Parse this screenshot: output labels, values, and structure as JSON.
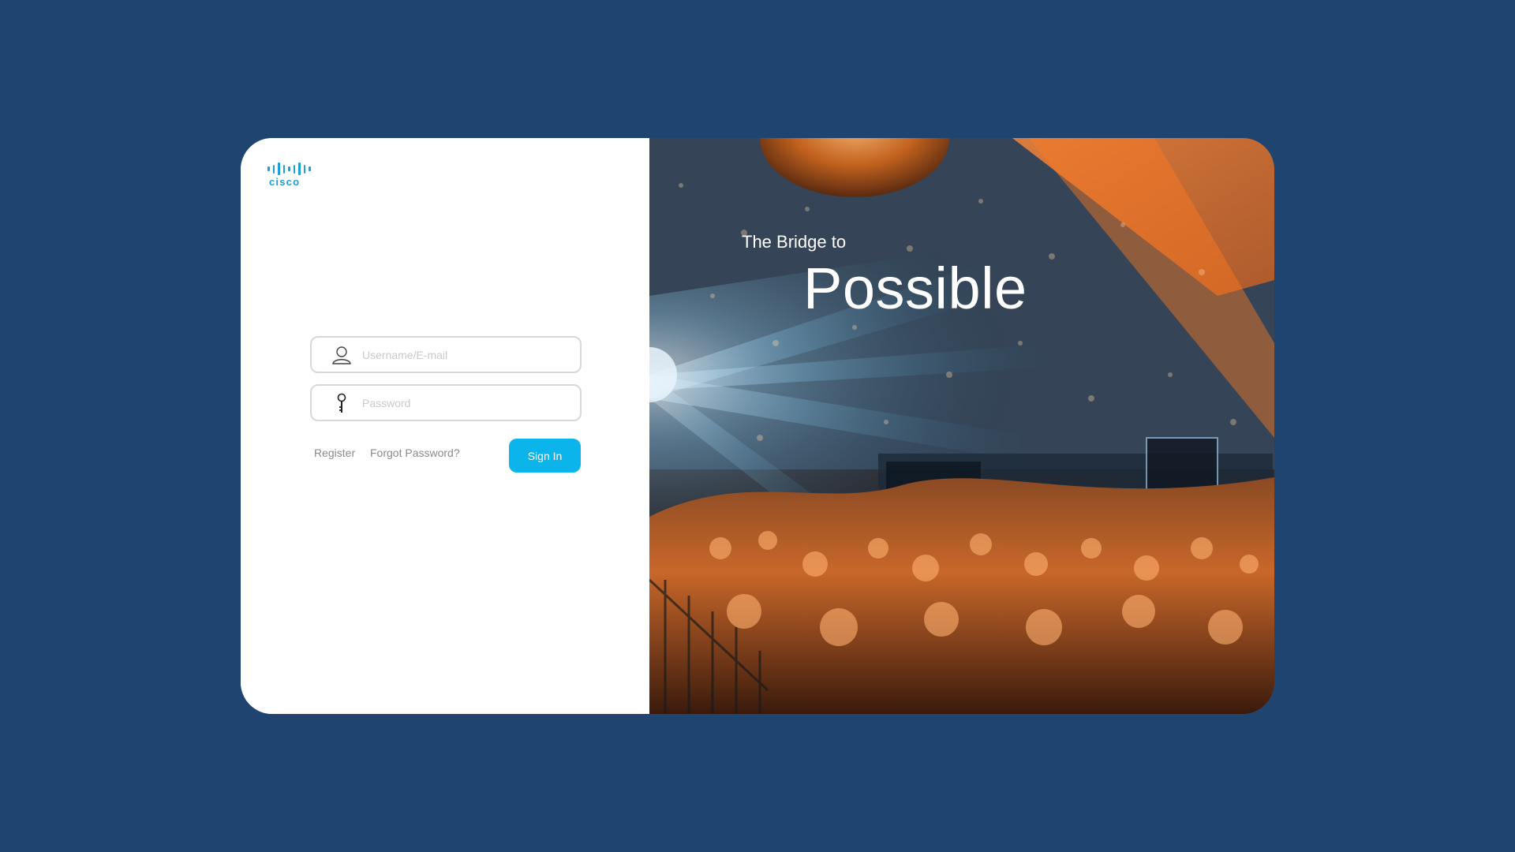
{
  "brand": {
    "logo_text": "cisco",
    "accent": "#1ba0d7"
  },
  "login": {
    "username_placeholder": "Username/E-mail",
    "password_placeholder": "Password",
    "register_label": "Register",
    "forgot_label": "Forgot Password?",
    "signin_label": "Sign In",
    "user_icon": "user-icon",
    "password_icon": "key-icon",
    "signin_color": "#0bb4ea"
  },
  "hero": {
    "tagline_small": "The Bridge to",
    "tagline_big": "Possible"
  },
  "colors": {
    "page_background": "#1f4470"
  }
}
